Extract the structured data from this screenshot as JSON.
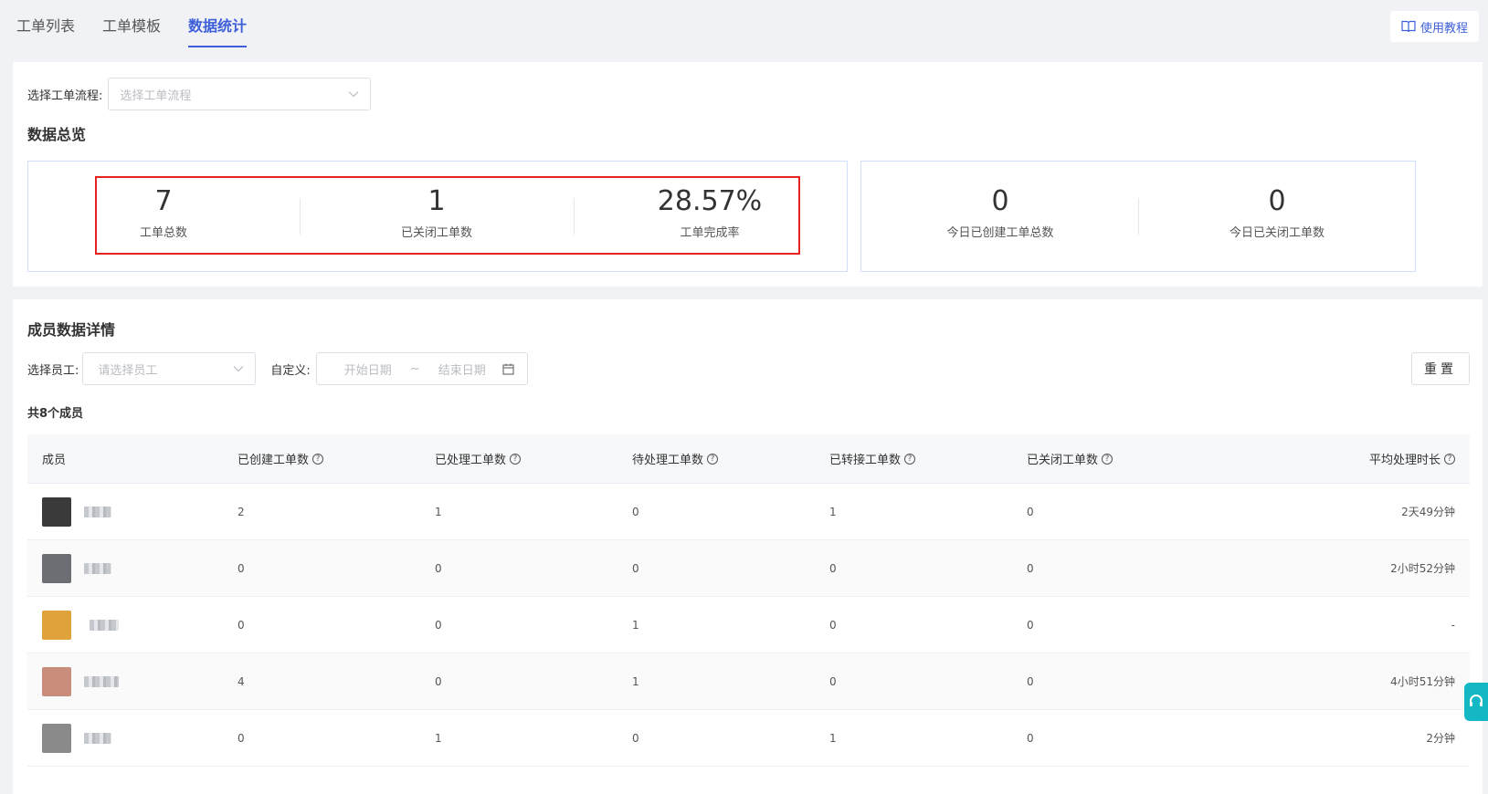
{
  "tabs": [
    {
      "label": "工单列表",
      "active": false
    },
    {
      "label": "工单模板",
      "active": false
    },
    {
      "label": "数据统计",
      "active": true
    }
  ],
  "help": {
    "label": "使用教程",
    "icon": "book-icon"
  },
  "flow_filter": {
    "label": "选择工单流程:",
    "placeholder": "选择工单流程"
  },
  "overview": {
    "title": "数据总览",
    "stats": [
      {
        "value": "7",
        "label": "工单总数"
      },
      {
        "value": "1",
        "label": "已关闭工单数"
      },
      {
        "value": "28.57%",
        "label": "工单完成率"
      }
    ],
    "today": [
      {
        "value": "0",
        "label": "今日已创建工单总数"
      },
      {
        "value": "0",
        "label": "今日已关闭工单数"
      }
    ]
  },
  "members": {
    "title": "成员数据详情",
    "employee_label": "选择员工:",
    "employee_placeholder": "请选择员工",
    "custom_label": "自定义:",
    "start_placeholder": "开始日期",
    "range_sep": "~",
    "end_placeholder": "结束日期",
    "reset_label": "重置",
    "count_text": "共8个成员",
    "columns": [
      "成员",
      "已创建工单数",
      "已处理工单数",
      "待处理工单数",
      "已转接工单数",
      "已关闭工单数",
      "平均处理时长"
    ],
    "rows": [
      {
        "created": "2",
        "handled": "1",
        "pending": "0",
        "transferred": "1",
        "closed": "0",
        "avg": "2天49分钟",
        "avatar_color": "#3a3a3a"
      },
      {
        "created": "0",
        "handled": "0",
        "pending": "0",
        "transferred": "0",
        "closed": "0",
        "avg": "2小时52分钟",
        "avatar_color": "#6b6e73"
      },
      {
        "created": "0",
        "handled": "0",
        "pending": "1",
        "transferred": "0",
        "closed": "0",
        "avg": "-",
        "avatar_color": "#e0a23a"
      },
      {
        "created": "4",
        "handled": "0",
        "pending": "1",
        "transferred": "0",
        "closed": "0",
        "avg": "4小时51分钟",
        "avatar_color": "#c98d7c"
      },
      {
        "created": "0",
        "handled": "1",
        "pending": "0",
        "transferred": "1",
        "closed": "0",
        "avg": "2分钟",
        "avatar_color": "#8a8a8a"
      }
    ]
  },
  "colors": {
    "accent": "#3d5fd9",
    "highlight": "#e52222",
    "float_button": "#14b8c4"
  }
}
